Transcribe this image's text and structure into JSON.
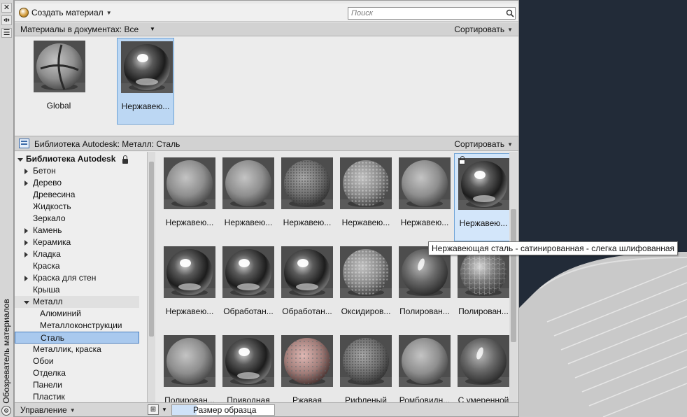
{
  "strip": {
    "title": "Обозреватель материалов",
    "btn_close": "✕",
    "btn_pin": "⇹",
    "btn_menu": "☰",
    "bottom_icon": "⚙"
  },
  "toolbar": {
    "create_label": "Создать материал",
    "search_placeholder": "Поиск"
  },
  "doc_bar": {
    "label": "Материалы в документах: Все",
    "sort_label": "Сортировать"
  },
  "document_materials": [
    {
      "label": "Global",
      "selected": false,
      "style": "matte"
    },
    {
      "label": "Нержавею...",
      "selected": true,
      "style": "chrome"
    }
  ],
  "library_bar": {
    "label": "Библиотека Autodesk: Металл: Сталь",
    "sort_label": "Сортировать"
  },
  "tree": [
    {
      "label": "Библиотека Autodesk",
      "level": 0,
      "arrow": "down",
      "bold": true,
      "locked": true
    },
    {
      "label": "Бетон",
      "level": 1,
      "arrow": "right"
    },
    {
      "label": "Дерево",
      "level": 1,
      "arrow": "right"
    },
    {
      "label": "Древесина",
      "level": 1,
      "arrow": ""
    },
    {
      "label": "Жидкость",
      "level": 1,
      "arrow": ""
    },
    {
      "label": "Зеркало",
      "level": 1,
      "arrow": ""
    },
    {
      "label": "Камень",
      "level": 1,
      "arrow": "right"
    },
    {
      "label": "Керамика",
      "level": 1,
      "arrow": "right"
    },
    {
      "label": "Кладка",
      "level": 1,
      "arrow": "right"
    },
    {
      "label": "Краска",
      "level": 1,
      "arrow": ""
    },
    {
      "label": "Краска для стен",
      "level": 1,
      "arrow": "right"
    },
    {
      "label": "Крыша",
      "level": 1,
      "arrow": ""
    },
    {
      "label": "Металл",
      "level": 1,
      "arrow": "down",
      "expanded": true
    },
    {
      "label": "Алюминий",
      "level": 2,
      "arrow": ""
    },
    {
      "label": "Металлоконструкции",
      "level": 2,
      "arrow": ""
    },
    {
      "label": "Сталь",
      "level": 2,
      "arrow": "",
      "selected": true
    },
    {
      "label": "Металлик, краска",
      "level": 1,
      "arrow": ""
    },
    {
      "label": "Обои",
      "level": 1,
      "arrow": ""
    },
    {
      "label": "Отделка",
      "level": 1,
      "arrow": ""
    },
    {
      "label": "Панели",
      "level": 1,
      "arrow": ""
    },
    {
      "label": "Пластик",
      "level": 1,
      "arrow": ""
    }
  ],
  "materials": [
    {
      "label": "Нержавею...",
      "style": "matte"
    },
    {
      "label": "Нержавею...",
      "style": "matte"
    },
    {
      "label": "Нержавею...",
      "style": "mesh"
    },
    {
      "label": "Нержавею...",
      "style": "dimple"
    },
    {
      "label": "Нержавею...",
      "style": "matte"
    },
    {
      "label": "Нержавею...",
      "style": "chrome",
      "selected": true,
      "locked": true
    },
    {
      "label": "Нержавею...",
      "style": "chrome"
    },
    {
      "label": "Обработан...",
      "style": "chrome"
    },
    {
      "label": "Обработан...",
      "style": "chrome"
    },
    {
      "label": "Оксидиров...",
      "style": "dimple"
    },
    {
      "label": "Полирован...",
      "style": "satin"
    },
    {
      "label": "Полирован...",
      "style": "hammered"
    },
    {
      "label": "Полирован...",
      "style": "matte"
    },
    {
      "label": "Приводная",
      "style": "chrome"
    },
    {
      "label": "Ржавая",
      "style": "rust"
    },
    {
      "label": "Рифленый",
      "style": "mesh"
    },
    {
      "label": "Ромбовидн...",
      "style": "matte"
    },
    {
      "label": "С умеренной",
      "style": "satin"
    }
  ],
  "tooltip": "Нержавеющая сталь - сатинированная - слегка шлифованная",
  "bottom": {
    "manage_label": "Управление",
    "view_icon": "⊞",
    "size_label": "Размер образца",
    "size_fraction": 0.24
  },
  "colors": {
    "selection": "#bcd7f3",
    "selection_border": "#6fa3d6",
    "viewport_bg": "#222b38"
  }
}
